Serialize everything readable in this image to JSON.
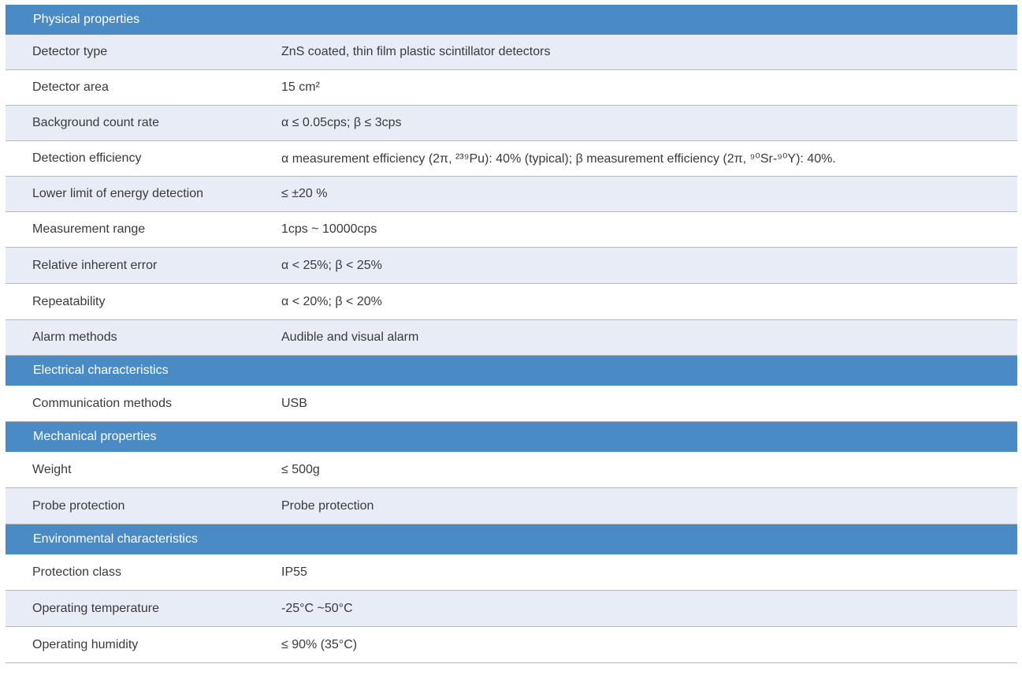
{
  "sections": [
    {
      "title": "Physical properties",
      "rows": [
        {
          "label": "Detector type",
          "value": "ZnS coated, thin film plastic scintillator detectors"
        },
        {
          "label": "Detector area",
          "value": "15 cm²"
        },
        {
          "label": "Background count rate",
          "value": "α ≤ 0.05cps; β ≤ 3cps"
        },
        {
          "label": "Detection efficiency",
          "value": "α measurement efficiency (2π, ²³⁹Pu): 40% (typical); β measurement efficiency (2π, ⁹⁰Sr-⁹⁰Y): 40%."
        },
        {
          "label": "Lower limit of energy detection",
          "value": "≤ ±20 %"
        },
        {
          "label": "Measurement range",
          "value": "1cps ~ 10000cps"
        },
        {
          "label": "Relative inherent error",
          "value": "α < 25%; β < 25%"
        },
        {
          "label": "Repeatability",
          "value": "α < 20%; β < 20%"
        },
        {
          "label": "Alarm methods",
          "value": "Audible and visual alarm"
        }
      ]
    },
    {
      "title": "Electrical characteristics",
      "rows": [
        {
          "label": "Communication methods",
          "value": "USB"
        }
      ]
    },
    {
      "title": "Mechanical properties",
      "rows": [
        {
          "label": "Weight",
          "value": "≤ 500g"
        },
        {
          "label": "Probe protection",
          "value": "Probe protection"
        }
      ]
    },
    {
      "title": "Environmental characteristics",
      "rows": [
        {
          "label": "Protection class",
          "value": "IP55"
        },
        {
          "label": "Operating temperature",
          "value": "-25°C ~50°C"
        },
        {
          "label": "Operating humidity",
          "value": "≤ 90% (35°C)"
        }
      ]
    }
  ],
  "colors": {
    "section_header_bg": "#4a8bc6",
    "alt_row_bg": "#e7ecf6",
    "text": "#3a3a3a"
  }
}
